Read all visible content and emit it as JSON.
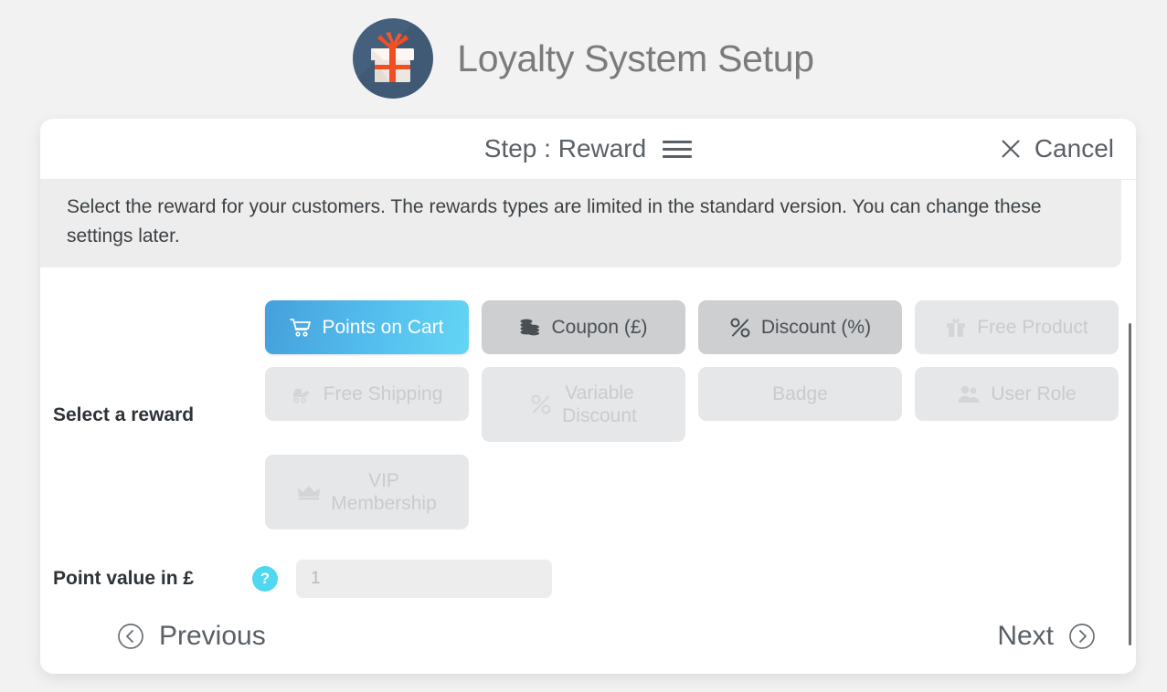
{
  "header": {
    "title": "Loyalty System Setup",
    "logo_icon": "gift-icon"
  },
  "modal": {
    "step_title": "Step : Reward",
    "menu_icon": "hamburger-menu-icon",
    "cancel_label": "Cancel",
    "cancel_icon": "close-icon",
    "description": "Select the reward for your customers. The rewards types are limited in the standard version. You can change these settings later."
  },
  "reward": {
    "label": "Select a reward",
    "options": [
      {
        "label": "Points on Cart",
        "icon": "shopping-cart-icon",
        "state": "selected"
      },
      {
        "label": "Coupon (£)",
        "icon": "coins-icon",
        "state": "enabled"
      },
      {
        "label": "Discount (%)",
        "icon": "percent-icon",
        "state": "enabled"
      },
      {
        "label": "Free Product",
        "icon": "gift-icon",
        "state": "disabled"
      },
      {
        "label": "Free Shipping",
        "icon": "shipping-truck-icon",
        "state": "disabled"
      },
      {
        "label": "Variable\nDiscount",
        "icon": "percent-icon",
        "state": "disabled"
      },
      {
        "label": "Badge",
        "icon": "none",
        "state": "disabled"
      },
      {
        "label": "User Role",
        "icon": "users-icon",
        "state": "disabled"
      },
      {
        "label": "VIP\nMembership",
        "icon": "crown-icon",
        "state": "disabled"
      }
    ]
  },
  "point_value": {
    "label": "Point value in £",
    "help_icon": "question-mark-icon",
    "help_text": "?",
    "placeholder": "1",
    "value": ""
  },
  "footer": {
    "previous_label": "Previous",
    "previous_icon": "chevron-left-circle-icon",
    "next_label": "Next",
    "next_icon": "chevron-right-circle-icon"
  },
  "colors": {
    "page_background": "#f2f2f2",
    "accent_selected_from": "#45a0db",
    "accent_selected_to": "#64d5f4",
    "help_badge": "#4fd8ef",
    "logo_circle": "#44607d",
    "logo_ribbon": "#f04e23",
    "text_primary": "#3c4145",
    "text_muted": "#7b7b7b",
    "button_enabled": "#cdcfd1",
    "button_disabled": "#e6e7e8"
  }
}
